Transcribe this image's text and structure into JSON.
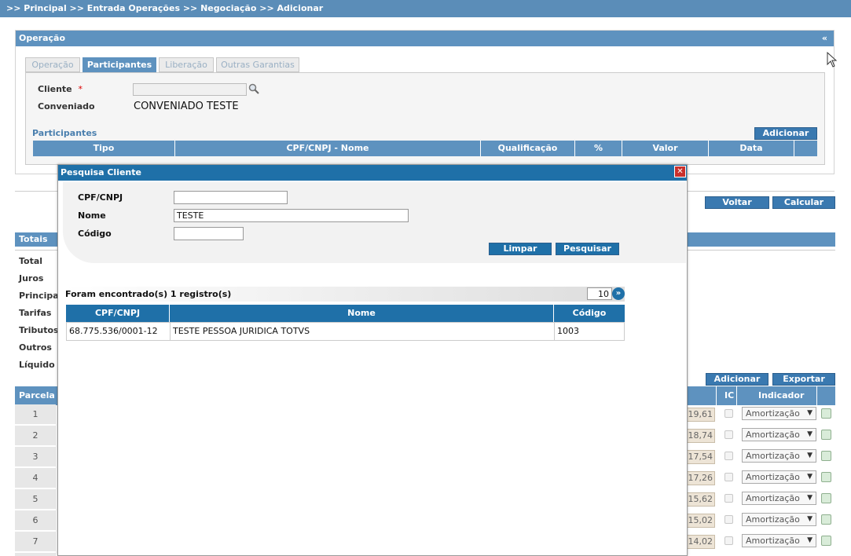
{
  "breadcrumb": ">> Principal >> Entrada Operações  >> Negociação  >> Adicionar",
  "operacao_panel": {
    "title": "Operação",
    "collapse": "«",
    "tabs": [
      "Operação",
      "Participantes",
      "Liberação",
      "Outras Garantias"
    ],
    "active_tab": "Participantes",
    "cliente_label": "Cliente",
    "required_mark": "*",
    "conveniado_label": "Conveniado",
    "conveniado_value": "CONVENIADO TESTE",
    "participantes_title": "Participantes",
    "adicionar": "Adicionar",
    "columns": [
      "Tipo",
      "CPF/CNPJ - Nome",
      "Qualificação",
      "%",
      "Valor",
      "Data"
    ]
  },
  "actions": {
    "voltar": "Voltar",
    "calcular": "Calcular"
  },
  "totais": {
    "title": "Totais",
    "items": [
      "Total",
      "Juros",
      "Principal",
      "Tarifas",
      "Tributos",
      "Outros",
      "Líquido"
    ]
  },
  "parcelas": {
    "adicionar": "Adicionar",
    "exportar": "Exportar",
    "col_parcela": "Parcela",
    "col_ic": "IC",
    "col_indicador": "Indicador",
    "rows": [
      {
        "n": "1",
        "valor": "19,61",
        "indicador": "Amortização"
      },
      {
        "n": "2",
        "valor": "18,74",
        "indicador": "Amortização"
      },
      {
        "n": "3",
        "valor": "17,54",
        "indicador": "Amortização"
      },
      {
        "n": "4",
        "valor": "17,26",
        "indicador": "Amortização"
      },
      {
        "n": "5",
        "valor": "15,62",
        "indicador": "Amortização"
      },
      {
        "n": "6",
        "valor": "15,02",
        "indicador": "Amortização"
      },
      {
        "n": "7",
        "valor": "14,02",
        "indicador": "Amortização"
      }
    ]
  },
  "dialog": {
    "title": "Pesquisa Cliente",
    "close": "✕",
    "cpf_label": "CPF/CNPJ",
    "cpf_value": "",
    "nome_label": "Nome",
    "nome_value": "TESTE",
    "codigo_label": "Código",
    "codigo_value": "",
    "limpar": "Limpar",
    "pesquisar": "Pesquisar",
    "results_text": "Foram encontrado(s) 1 registro(s)",
    "page_size": "10",
    "columns": [
      "CPF/CNPJ",
      "Nome",
      "Código"
    ],
    "rows": [
      {
        "cpf": "68.775.536/0001-12",
        "nome": "TESTE PESSOA JURIDICA TOTVS",
        "codigo": "1003"
      }
    ]
  },
  "icons": {
    "search": "magnifier-icon",
    "next": "double-chevron-icon",
    "close": "close-icon",
    "edit": "edit-icon"
  }
}
